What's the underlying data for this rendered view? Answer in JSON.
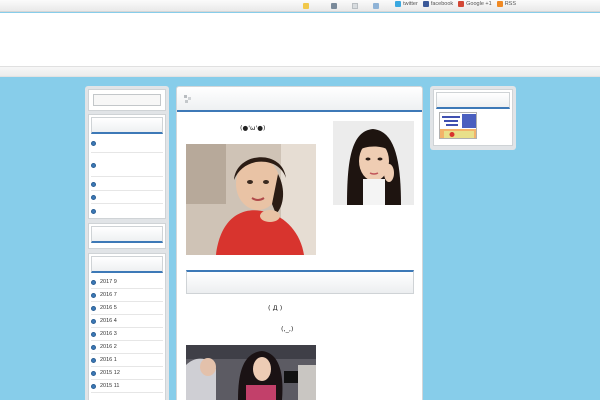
{
  "topbar": {
    "social": [
      {
        "label": "twitter",
        "icon": "twitter-icon",
        "color": "#3aa8e0"
      },
      {
        "label": "facebook",
        "icon": "facebook-icon",
        "color": "#3b5998"
      },
      {
        "label": "Google +1",
        "icon": "google-plus-icon",
        "color": "#d34836"
      },
      {
        "label": "RSS",
        "icon": "rss-icon",
        "color": "#f08a24"
      }
    ]
  },
  "post": {
    "emoticon_1": "(●'ω'●)",
    "emoticon_2": "( Д )",
    "emoticon_3": "(,_,)"
  },
  "sidebar": {
    "archives": [
      "2017 9",
      "2016 7",
      "2016 5",
      "2016 4",
      "2016 3",
      "2016 2",
      "2016 1",
      "2015 12",
      "2015 11"
    ]
  },
  "colors": {
    "background": "#87cdea",
    "accent": "#3d79b7"
  }
}
